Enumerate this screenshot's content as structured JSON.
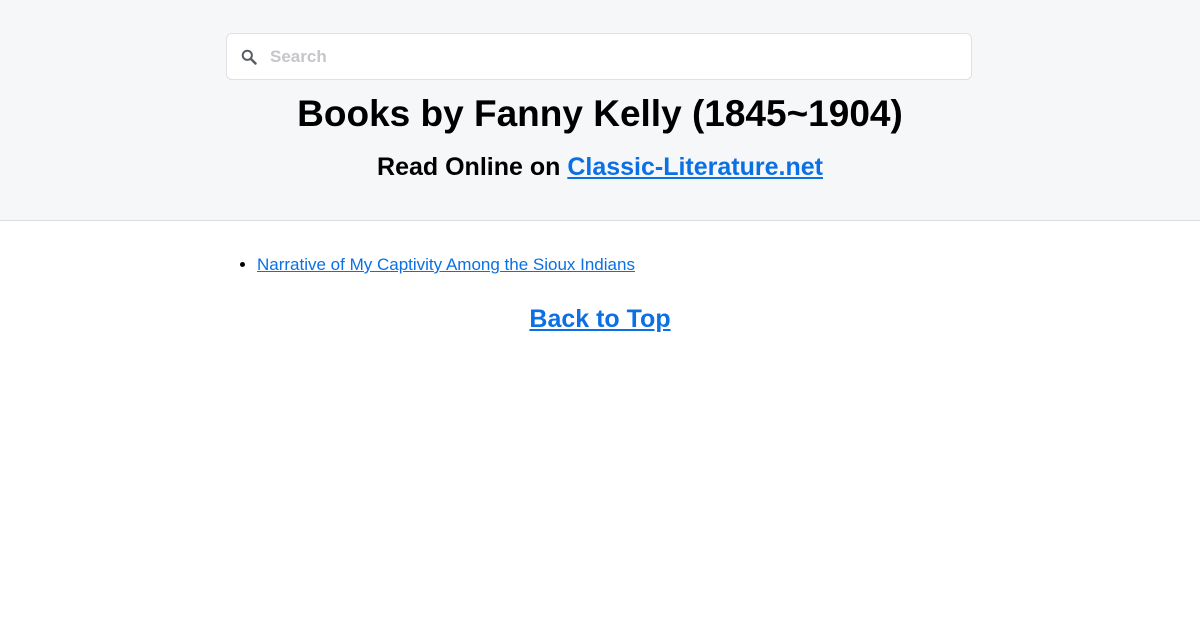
{
  "search": {
    "placeholder": "Search",
    "value": ""
  },
  "header": {
    "title": "Books by Fanny Kelly (1845~1904)",
    "subtitle_prefix": "Read Online on ",
    "site_link": "Classic-Literature.net"
  },
  "books": [
    {
      "title": "Narrative of My Captivity Among the Sioux Indians"
    }
  ],
  "footer": {
    "back_to_top": "Back to Top"
  },
  "icons": {
    "search": "search-icon"
  },
  "colors": {
    "link": "#0a70e4",
    "header_bg": "#f6f7f9"
  }
}
